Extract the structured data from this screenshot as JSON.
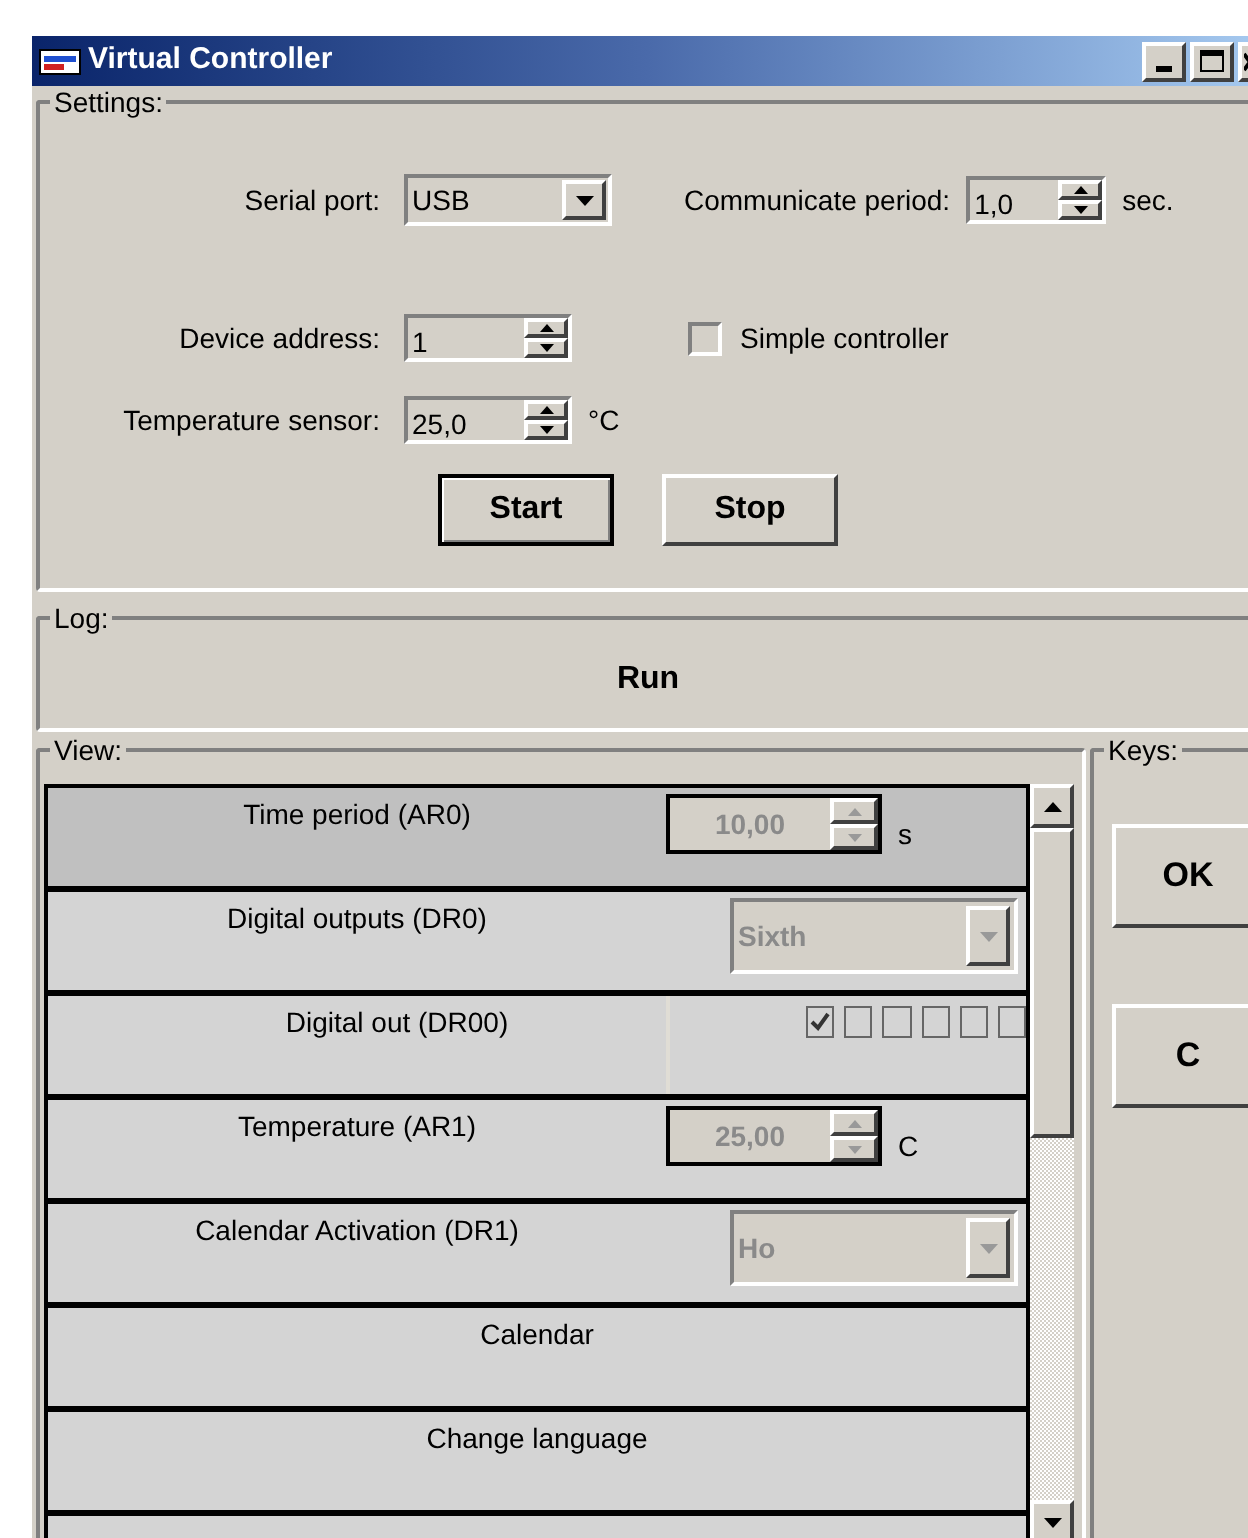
{
  "window": {
    "title": "Virtual Controller"
  },
  "settings": {
    "title": "Settings:",
    "serial_port": {
      "label": "Serial port:",
      "value": "USB"
    },
    "communicate_period": {
      "label": "Communicate period:",
      "value": "1,0",
      "unit": "sec."
    },
    "device_address": {
      "label": "Device address:",
      "value": "1"
    },
    "simple_controller": {
      "label": "Simple controller",
      "checked": false
    },
    "temperature_sensor": {
      "label": "Temperature sensor:",
      "value": "25,0",
      "unit": "°C"
    },
    "buttons": [
      {
        "label": "Start",
        "default": true
      },
      {
        "label": "Stop",
        "default": false
      }
    ]
  },
  "log": {
    "title": "Log:",
    "message": "Run"
  },
  "view": {
    "title": "View:",
    "rows": [
      {
        "kind": "spin",
        "label": "Time period (AR0)",
        "value": "10,00",
        "unit": "s",
        "disabled": true,
        "selected": true
      },
      {
        "kind": "combo",
        "label": "Digital outputs (DR0)",
        "value": "Sixth",
        "disabled": true,
        "selected": false
      },
      {
        "kind": "checks",
        "label": "Digital out (DR00)",
        "checks": [
          {
            "checked": true
          },
          {
            "checked": false
          },
          {
            "checked": false
          },
          {
            "checked": false
          },
          {
            "checked": false
          },
          {
            "checked": false
          }
        ],
        "selected": false
      },
      {
        "kind": "spin",
        "label": "Temperature (AR1)",
        "value": "25,00",
        "unit": "C",
        "disabled": true,
        "selected": false
      },
      {
        "kind": "combo",
        "label": "Calendar Activation (DR1)",
        "value": "Ho",
        "disabled": true,
        "selected": false
      },
      {
        "kind": "button",
        "label": "Calendar",
        "selected": false
      },
      {
        "kind": "button",
        "label": "Change language",
        "selected": false
      }
    ]
  },
  "keys": {
    "title": "Keys:",
    "buttons": [
      "OK",
      "C"
    ]
  }
}
